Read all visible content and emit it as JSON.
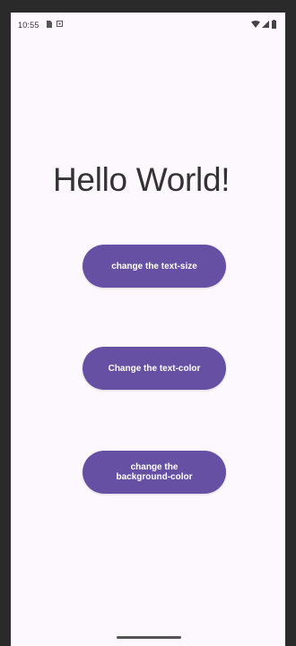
{
  "status_bar": {
    "time": "10:55",
    "icons": [
      "sim-card-icon",
      "media-icon",
      "wifi-icon",
      "signal-icon",
      "battery-icon"
    ]
  },
  "main": {
    "title": "Hello World!",
    "buttons": [
      {
        "label": "change the text-size"
      },
      {
        "label": "Change the text-color"
      },
      {
        "label": "change the background-color"
      }
    ]
  },
  "colors": {
    "accent": "#6650a4",
    "background": "#fdf8fd",
    "text": "#333333"
  }
}
